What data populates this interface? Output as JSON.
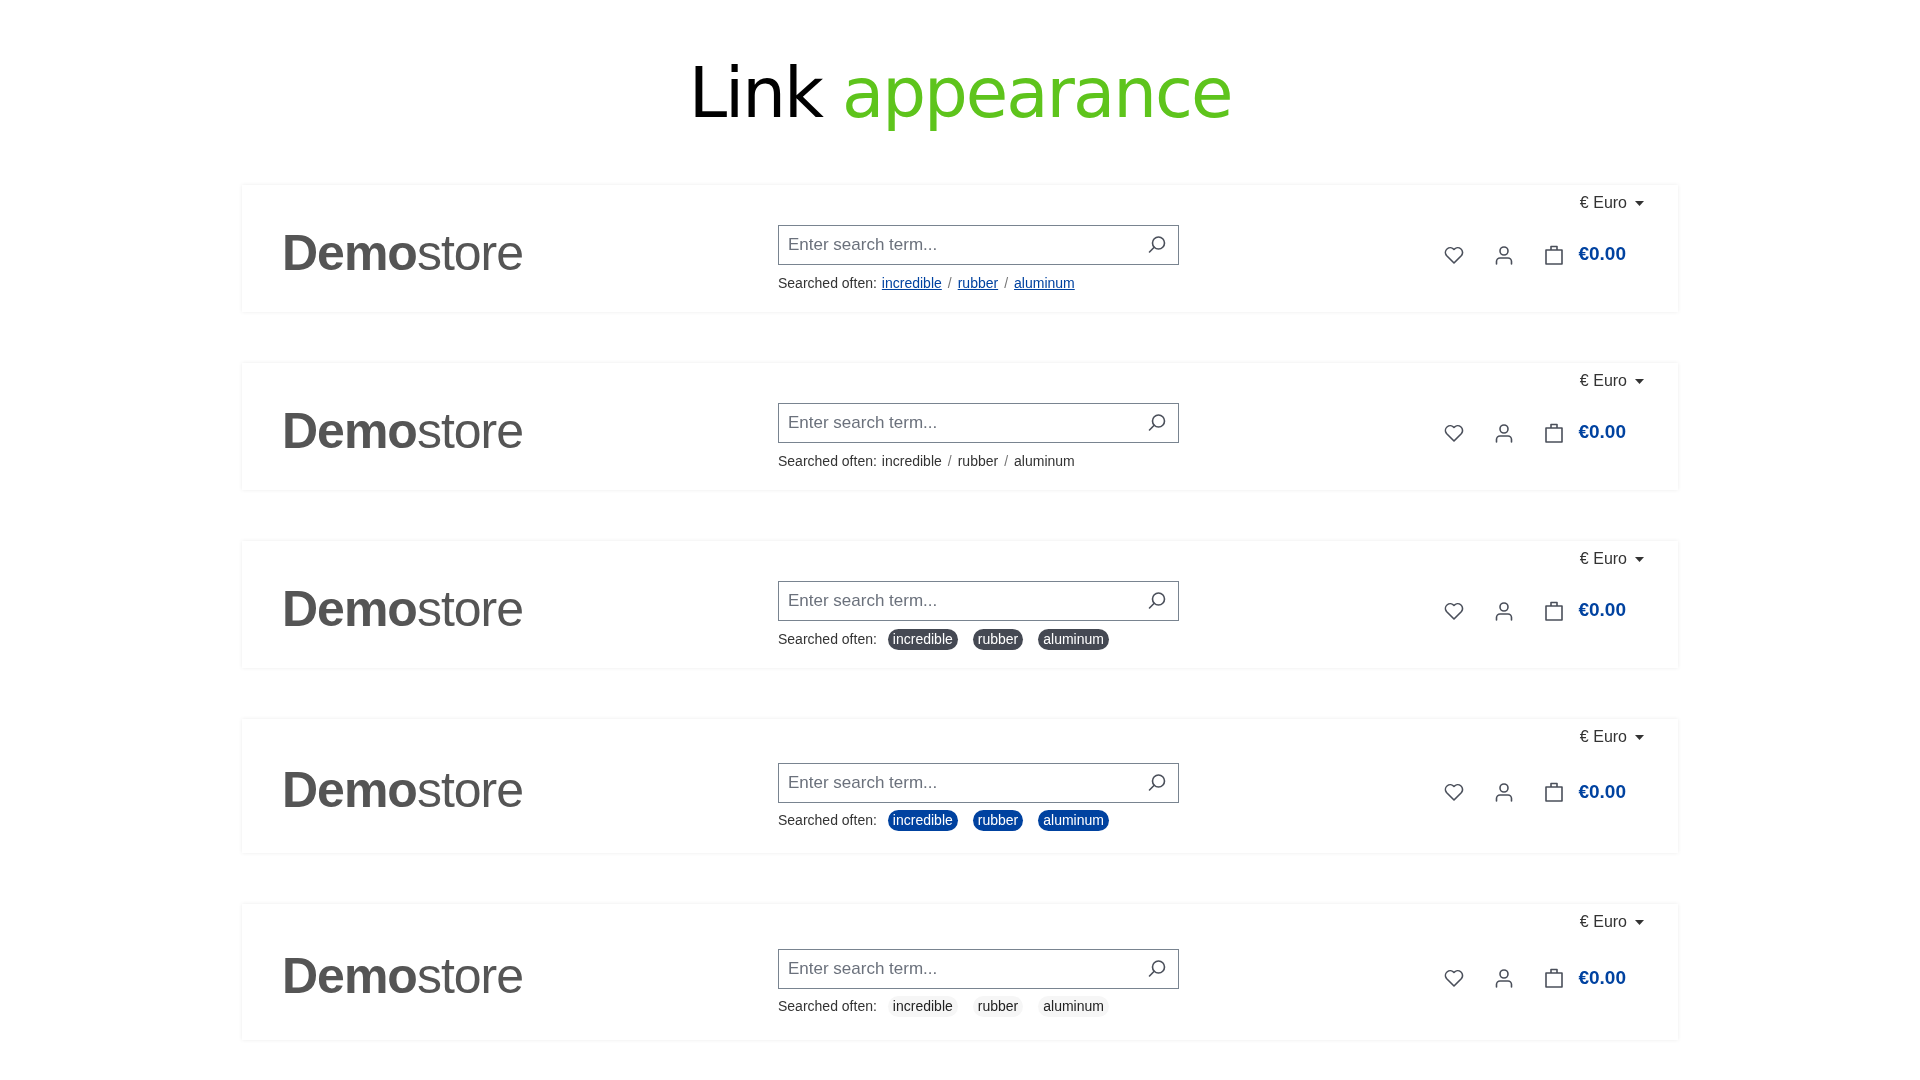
{
  "title": {
    "lead": "Link",
    "accent": "appearance"
  },
  "headers": [
    {
      "kind": "underline",
      "logo_bold": "Demo",
      "logo_light": "store",
      "search": {
        "placeholder": "Enter search term..."
      },
      "searched_label": "Searched often:",
      "terms": [
        "incredible",
        "rubber",
        "aluminum"
      ],
      "separator": "/",
      "currency": "€ Euro",
      "cart_total": "€0.00"
    },
    {
      "kind": "plain",
      "logo_bold": "Demo",
      "logo_light": "store",
      "search": {
        "placeholder": "Enter search term..."
      },
      "searched_label": "Searched often:",
      "terms": [
        "incredible",
        "rubber",
        "aluminum"
      ],
      "separator": "/",
      "currency": "€ Euro",
      "cart_total": "€0.00"
    },
    {
      "kind": "pill-dark",
      "logo_bold": "Demo",
      "logo_light": "store",
      "search": {
        "placeholder": "Enter search term..."
      },
      "searched_label": "Searched often:",
      "terms": [
        "incredible",
        "rubber",
        "aluminum"
      ],
      "currency": "€ Euro",
      "cart_total": "€0.00"
    },
    {
      "kind": "pill-blue",
      "logo_bold": "Demo",
      "logo_light": "store",
      "search": {
        "placeholder": "Enter search term..."
      },
      "searched_label": "Searched often:",
      "terms": [
        "incredible",
        "rubber",
        "aluminum"
      ],
      "currency": "€ Euro",
      "cart_total": "€0.00"
    },
    {
      "kind": "pill-light",
      "logo_bold": "Demo",
      "logo_light": "store",
      "search": {
        "placeholder": "Enter search term..."
      },
      "searched_label": "Searched often:",
      "terms": [
        "incredible",
        "rubber",
        "aluminum"
      ],
      "currency": "€ Euro",
      "cart_total": "€0.00"
    }
  ]
}
